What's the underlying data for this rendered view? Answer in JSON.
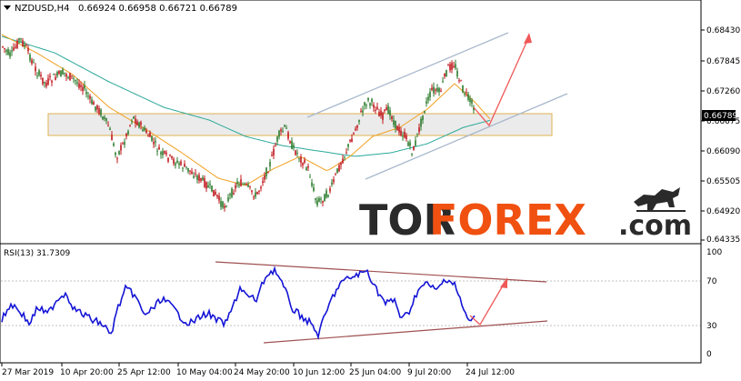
{
  "header": {
    "symbol": "NZDUSD,H4",
    "ohlc": "0.66924 0.66958 0.66721 0.66789"
  },
  "rsi": {
    "label": "RSI(13) 31.7309"
  },
  "price_axis": [
    "0.68430",
    "0.67845",
    "0.67260",
    "0.66675",
    "0.66090",
    "0.65505",
    "0.64920",
    "0.64335"
  ],
  "current_price": "0.66789",
  "rsi_axis": [
    "100",
    "70",
    "30",
    "0"
  ],
  "time_axis": [
    "27 Mar 2019",
    "10 Apr 20:00",
    "25 Apr 12:00",
    "10 May 04:00",
    "24 May 20:00",
    "10 Jun 12:00",
    "25 Jun 04:00",
    "9 Jul 20:00",
    "24 Jul 12:00"
  ],
  "brand": {
    "tor": "TOR",
    "forex": "FOREX",
    "dotcom": ".com"
  },
  "colors": {
    "bull_candle": "#2a7a2a",
    "bear_candle": "#c0141a",
    "ma_fast": "#f0a020",
    "ma_slow": "#2aa898",
    "rsi_line": "#1414d6",
    "zone_fill": "#e8e8e8",
    "zone_border": "#e0b050",
    "channel": "#a8b8cc",
    "arrow": "#f05858",
    "rsi_trend": "#a05050",
    "brand_dark": "#2a2a2a",
    "brand_orange": "#f05010"
  },
  "chart_data": {
    "type": "candlestick",
    "symbol": "NZDUSD",
    "timeframe": "H4",
    "price_range": [
      0.64335,
      0.6868
    ],
    "approx_close_path": [
      {
        "t": "27 Mar 2019",
        "price": 0.683
      },
      {
        "t": "10 Apr 20:00",
        "price": 0.676
      },
      {
        "t": "25 Apr 12:00",
        "price": 0.667
      },
      {
        "t": "10 May 04:00",
        "price": 0.653
      },
      {
        "t": "24 May 20:00",
        "price": 0.6545
      },
      {
        "t": "10 Jun 12:00",
        "price": 0.6505
      },
      {
        "t": "25 Jun 04:00",
        "price": 0.671
      },
      {
        "t": "9 Jul 20:00",
        "price": 0.664
      },
      {
        "t": "24 Jul 12:00",
        "price": 0.6679
      }
    ],
    "support_zone": [
      0.6652,
      0.6683
    ],
    "rsi_range": [
      0,
      100
    ],
    "rsi_levels": [
      70,
      30
    ],
    "rsi_last": 31.7309
  }
}
